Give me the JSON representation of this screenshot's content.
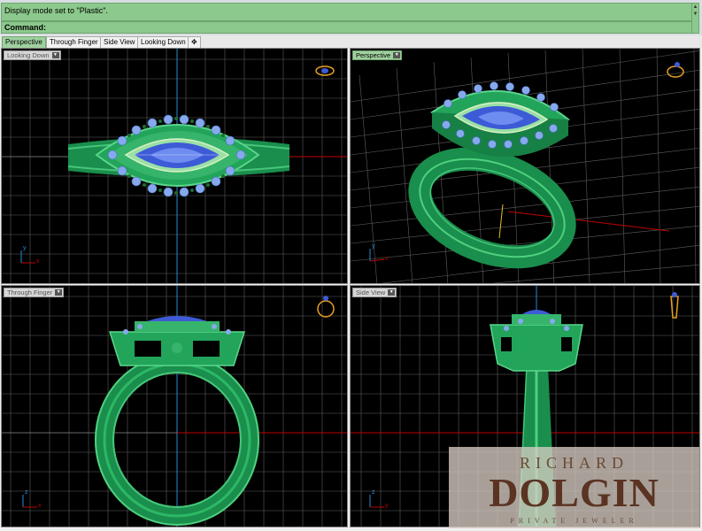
{
  "command_area": {
    "history_text": "Display mode set to \"Plastic\".",
    "prompt_label": "Command:"
  },
  "tabs": [
    {
      "label": "Perspective",
      "active": true
    },
    {
      "label": "Through Finger",
      "active": false
    },
    {
      "label": "Side View",
      "active": false
    },
    {
      "label": "Looking Down",
      "active": false
    },
    {
      "label": "✥",
      "active": false
    }
  ],
  "viewports": [
    {
      "label": "Looking Down",
      "active": false
    },
    {
      "label": "Perspective",
      "active": true
    },
    {
      "label": "Through Finger",
      "active": false
    },
    {
      "label": "Side View",
      "active": false
    }
  ],
  "axis_letters": {
    "x": "x",
    "y": "y",
    "z": "z"
  },
  "watermark": {
    "line1": "RICHARD",
    "line2": "DOLGIN",
    "line3": "PRIVATE JEWELER"
  },
  "colors": {
    "metal": "#1fa85a",
    "metal_light": "#4fd07f",
    "stone": "#3d5bd6",
    "accent_stone": "#7fa2ea",
    "grid": "#6a6a6a",
    "grid_major": "#9a9a9a",
    "x_axis": "#c00000",
    "y_axis": "#2a8ad0",
    "cmd_green": "#8cc98c"
  }
}
